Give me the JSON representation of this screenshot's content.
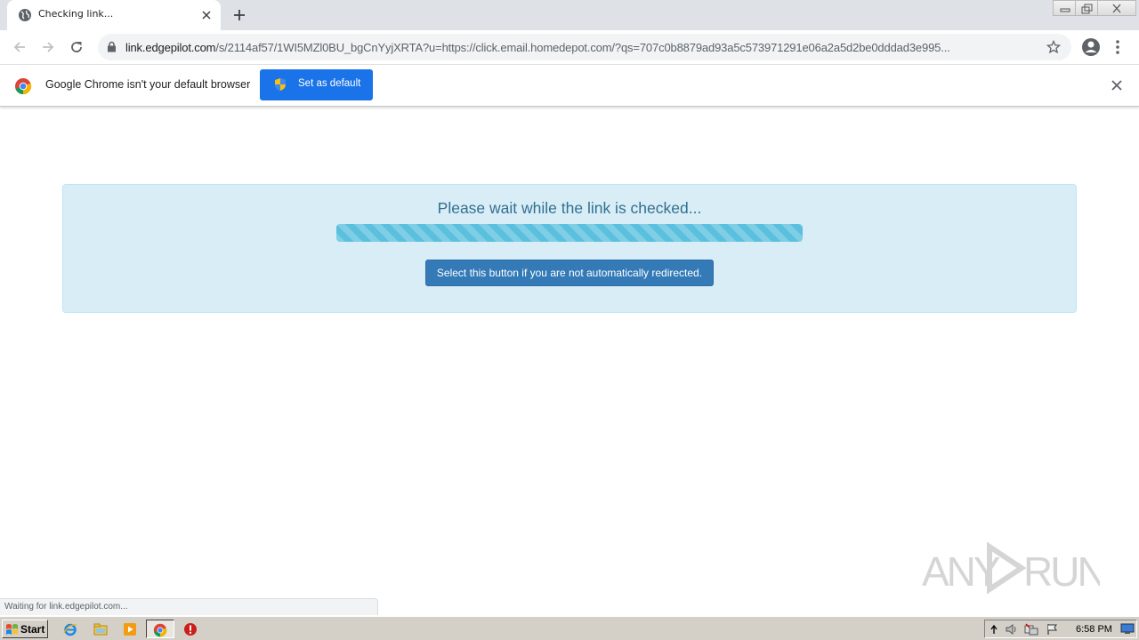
{
  "browser": {
    "tab": {
      "title": "Checking link..."
    },
    "address": {
      "host": "link.edgepilot.com",
      "path": "/s/2114af57/1WI5MZl0BU_bgCnYyjXRTA?u=https://click.email.homedepot.com/?qs=707c0b8879ad93a5c573971291e06a2a5d2be0dddad3e995..."
    }
  },
  "infobar": {
    "message": "Google Chrome isn't your default browser",
    "button_label": "Set as default",
    "accent": "#1a73e8"
  },
  "page": {
    "heading": "Please wait while the link is checked...",
    "progress": 1.0,
    "redirect_button": "Select this button if you are not automatically redirected."
  },
  "status": {
    "text": "Waiting for link.edgepilot.com..."
  },
  "watermark": {
    "text": "ANY RUN"
  },
  "taskbar": {
    "start_label": "Start",
    "clock": "6:58 PM",
    "icons": [
      "ie-icon",
      "explorer-icon",
      "media-player-icon",
      "chrome-icon",
      "security-alert-icon"
    ]
  }
}
